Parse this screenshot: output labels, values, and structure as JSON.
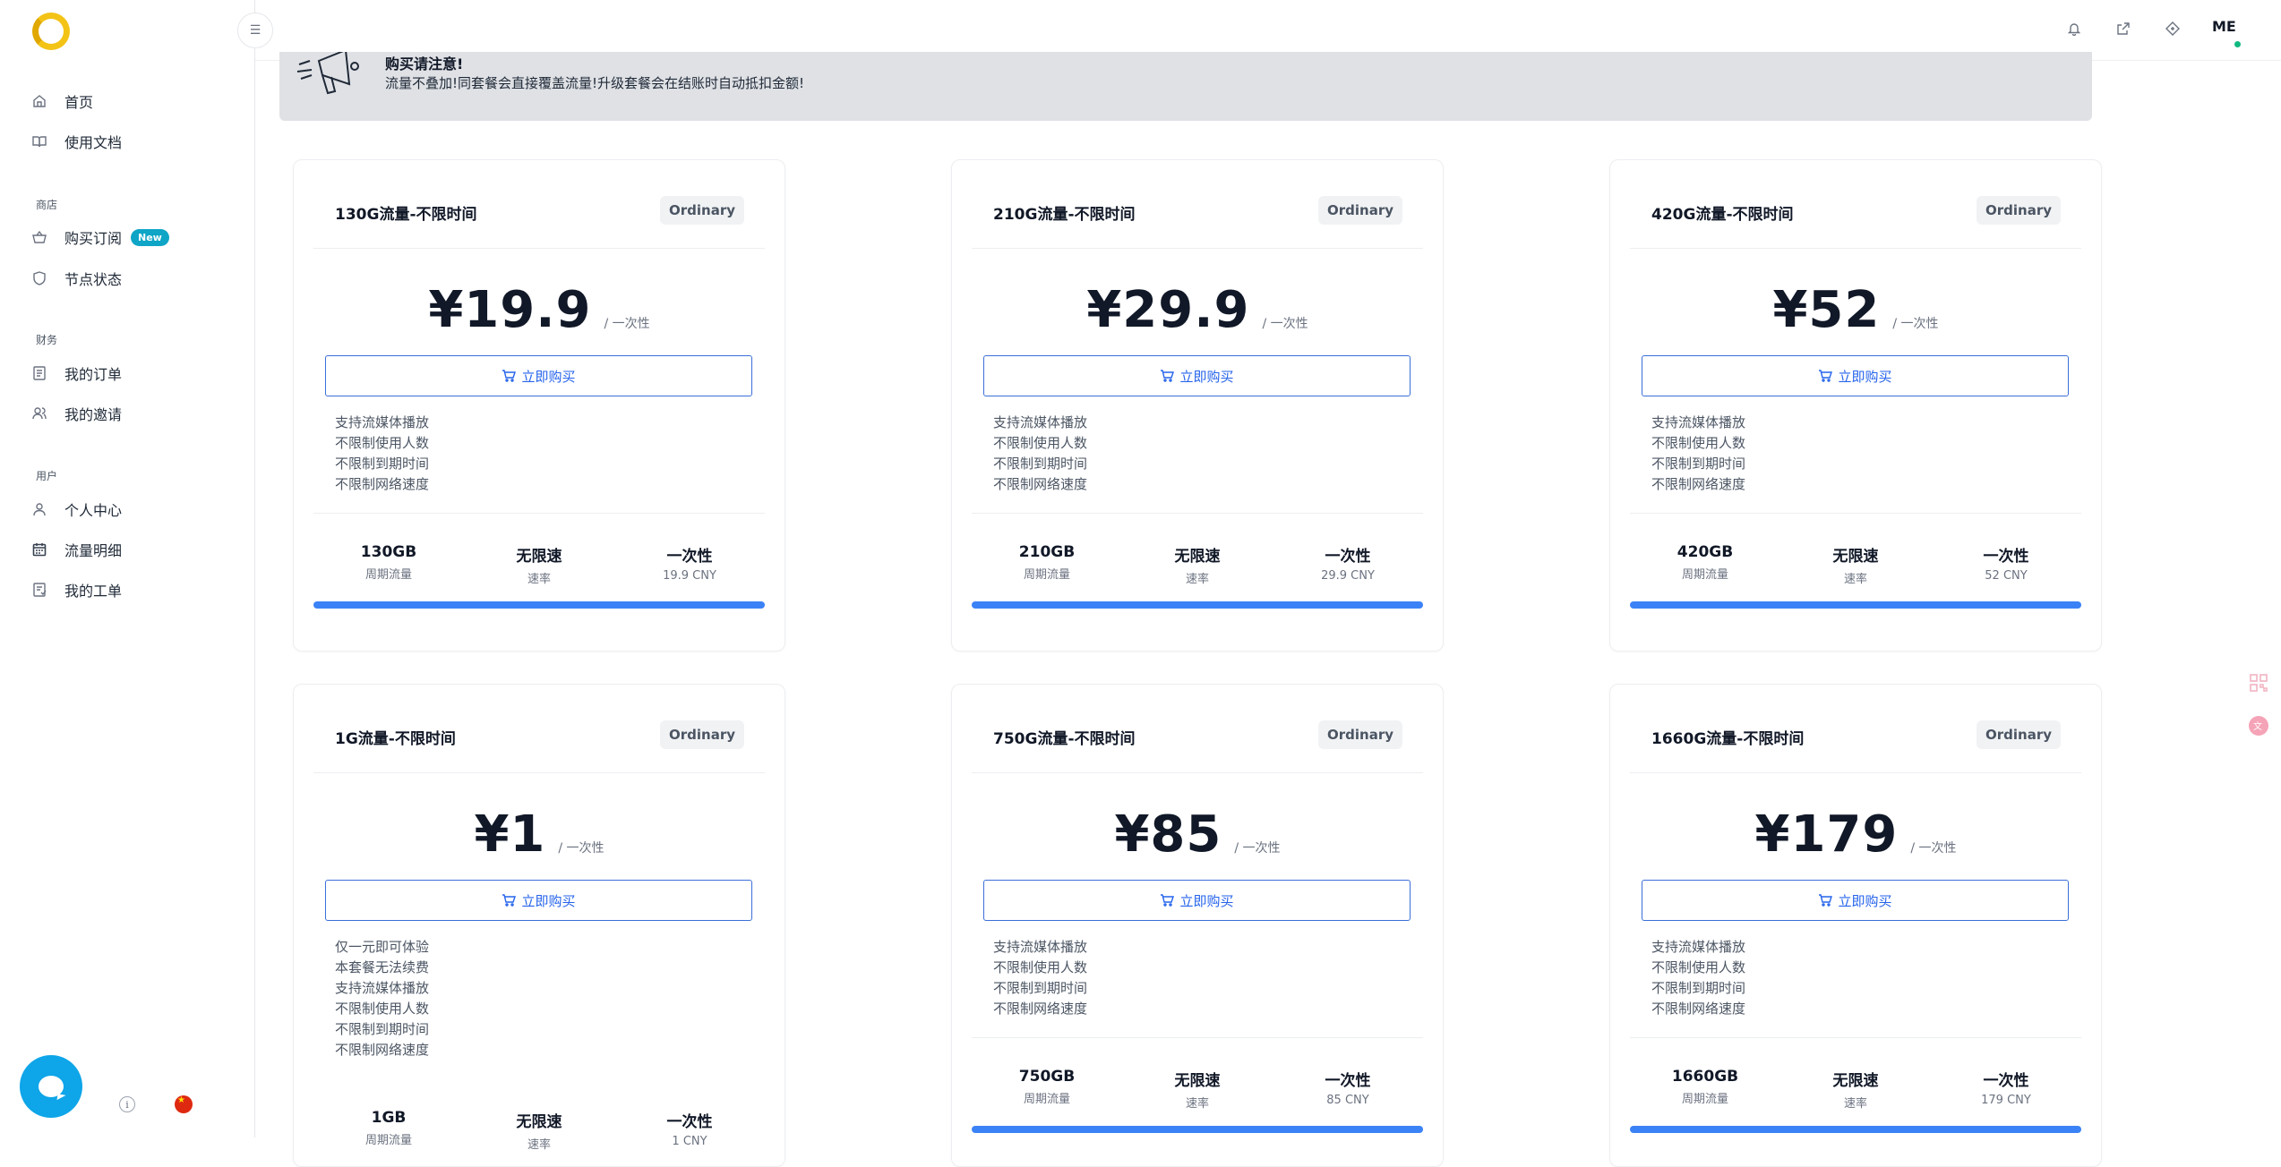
{
  "sidebar": {
    "home": "首页",
    "docs": "使用文档",
    "section_store": "商店",
    "buy": "购买订阅",
    "buy_badge": "New",
    "nodes": "节点状态",
    "section_finance": "财务",
    "orders": "我的订单",
    "invites": "我的邀请",
    "section_user": "用户",
    "profile": "个人中心",
    "traffic": "流量明细",
    "tickets": "我的工单"
  },
  "header": {
    "avatar_text": "ME",
    "menu_icon": "☰"
  },
  "notice": {
    "title": "购买请注意!",
    "text": "流量不叠加!同套餐会直接覆盖流量!升级套餐会在结账时自动抵扣金额!"
  },
  "plans": [
    {
      "title": "130G流量-不限时间",
      "tag": "Ordinary",
      "price": "¥19.9",
      "period": "/ 一次性",
      "buy_label": "立即购买",
      "features": [
        "支持流媒体播放",
        "不限制使用人数",
        "不限制到期时间",
        "不限制网络速度"
      ],
      "traffic": "130GB",
      "traffic_label": "周期流量",
      "speed": "无限速",
      "speed_label": "速率",
      "cycle": "一次性",
      "cycle_price": "19.9 CNY"
    },
    {
      "title": "210G流量-不限时间",
      "tag": "Ordinary",
      "price": "¥29.9",
      "period": "/ 一次性",
      "buy_label": "立即购买",
      "features": [
        "支持流媒体播放",
        "不限制使用人数",
        "不限制到期时间",
        "不限制网络速度"
      ],
      "traffic": "210GB",
      "traffic_label": "周期流量",
      "speed": "无限速",
      "speed_label": "速率",
      "cycle": "一次性",
      "cycle_price": "29.9 CNY"
    },
    {
      "title": "420G流量-不限时间",
      "tag": "Ordinary",
      "price": "¥52",
      "period": "/ 一次性",
      "buy_label": "立即购买",
      "features": [
        "支持流媒体播放",
        "不限制使用人数",
        "不限制到期时间",
        "不限制网络速度"
      ],
      "traffic": "420GB",
      "traffic_label": "周期流量",
      "speed": "无限速",
      "speed_label": "速率",
      "cycle": "一次性",
      "cycle_price": "52 CNY"
    },
    {
      "title": "1G流量-不限时间",
      "tag": "Ordinary",
      "price": "¥1",
      "period": "/ 一次性",
      "buy_label": "立即购买",
      "features": [
        "仅一元即可体验",
        "本套餐无法续费",
        "支持流媒体播放",
        "不限制使用人数",
        "不限制到期时间",
        "不限制网络速度"
      ],
      "traffic": "1GB",
      "traffic_label": "周期流量",
      "speed": "无限速",
      "speed_label": "速率",
      "cycle": "一次性",
      "cycle_price": "1 CNY"
    },
    {
      "title": "750G流量-不限时间",
      "tag": "Ordinary",
      "price": "¥85",
      "period": "/ 一次性",
      "buy_label": "立即购买",
      "features": [
        "支持流媒体播放",
        "不限制使用人数",
        "不限制到期时间",
        "不限制网络速度"
      ],
      "traffic": "750GB",
      "traffic_label": "周期流量",
      "speed": "无限速",
      "speed_label": "速率",
      "cycle": "一次性",
      "cycle_price": "85 CNY"
    },
    {
      "title": "1660G流量-不限时间",
      "tag": "Ordinary",
      "price": "¥179",
      "period": "/ 一次性",
      "buy_label": "立即购买",
      "features": [
        "支持流媒体播放",
        "不限制使用人数",
        "不限制到期时间",
        "不限制网络速度"
      ],
      "traffic": "1660GB",
      "traffic_label": "周期流量",
      "speed": "无限速",
      "speed_label": "速率",
      "cycle": "一次性",
      "cycle_price": "179 CNY"
    }
  ],
  "colors": {
    "accent": "#3b82f6",
    "badge": "#0ea5c6",
    "chat": "#0ea5e9"
  }
}
